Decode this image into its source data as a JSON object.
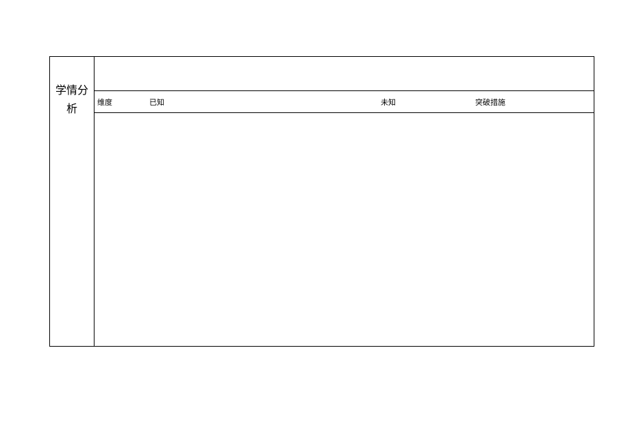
{
  "table": {
    "rowHeader": "学情分析",
    "columns": {
      "dimension": "维度",
      "known": "已知",
      "unknown": "未知",
      "measures": "突破措施"
    }
  }
}
